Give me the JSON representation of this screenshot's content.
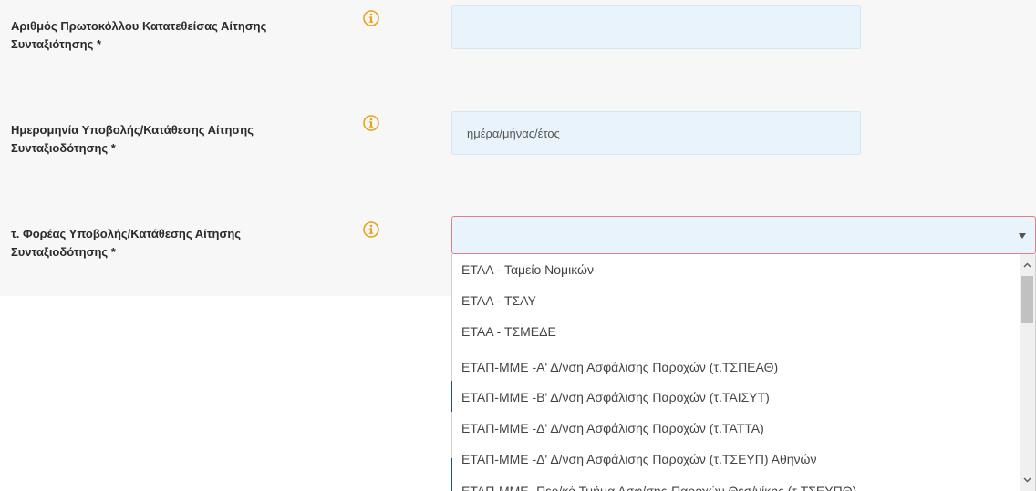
{
  "fields": [
    {
      "label_line1": "Αριθμός Πρωτοκόλλου Κατατεθείσας Αίτησης",
      "label_line2": "Συνταξιότησης *",
      "value": "",
      "placeholder": ""
    },
    {
      "label_line1": "Ημερομηνία Υποβολής/Κατάθεσης Αίτησης",
      "label_line2": "Συνταξιοδότησης *",
      "value": "",
      "placeholder": "ημέρα/μήνας/έτος"
    },
    {
      "label_line1": "τ. Φορέας Υποβολής/Κατάθεσης Αίτησης",
      "label_line2": "Συνταξιοδότησης *",
      "selected": ""
    }
  ],
  "dropdown": {
    "options": [
      "ΕΤΑΑ - Ταμείο Νομικών",
      "ΕΤΑΑ - ΤΣΑΥ",
      "ΕΤΑΑ - ΤΣΜΕΔΕ",
      "ΕΤΑΠ-ΜΜΕ -Α' Δ/νση Ασφάλισης Παροχών (τ.ΤΣΠΕΑΘ)",
      "ΕΤΑΠ-ΜΜΕ -Β' Δ/νση Ασφάλισης Παροχών (τ.ΤΑΙΣΥΤ)",
      "ΕΤΑΠ-ΜΜΕ -Δ' Δ/νση Ασφάλισης Παροχών (τ.ΤΑΤΤΑ)",
      "ΕΤΑΠ-ΜΜΕ -Δ' Δ/νση Ασφάλισης Παροχών (τ.ΤΣΕΥΠ) Αθηνών",
      "ΕΤΑΠ-ΜΜΕ -Περ/κό Τμήμα Ασφ/σης-Παροχών Θεσ/νίκης (τ.ΤΣΕΥΠΘ)"
    ]
  },
  "icons": {
    "info": "info-circle-icon",
    "dropdown_arrow": "caret-down-icon",
    "scroll_up": "scroll-up-arrow-icon",
    "scroll_down": "scroll-down-arrow-icon"
  },
  "colors": {
    "info_icon": "#e8a317",
    "input_bg": "#e8f3fb",
    "invalid_border": "#e27f85",
    "panel_bg": "#f7f7f7"
  }
}
